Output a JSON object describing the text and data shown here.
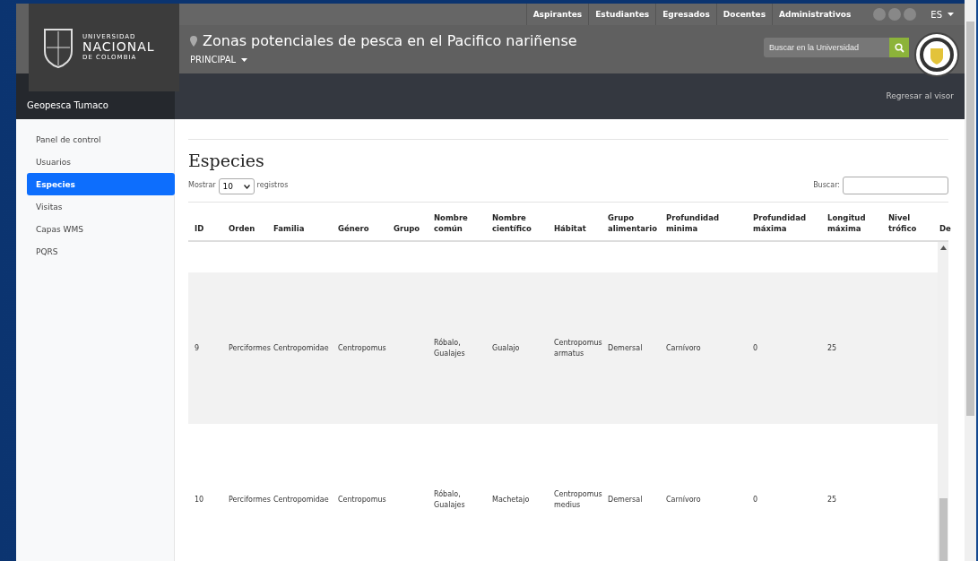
{
  "top_links": [
    "Aspirantes",
    "Estudiantes",
    "Egresados",
    "Docentes",
    "Administrativos"
  ],
  "language": "ES",
  "logo": {
    "line1": "UNIVERSIDAD",
    "line2": "NACIONAL",
    "line3": "DE COLOMBIA"
  },
  "site_title": "Zonas potenciales de pesca en el Pacifico nariñense",
  "menu": "PRINCIPAL",
  "search": {
    "placeholder": "Buscar en la Universidad"
  },
  "app_name": "Geopesca Tumaco",
  "back_link": "Regresar al visor",
  "sidebar": {
    "items": [
      {
        "label": "Panel de control",
        "selected": false
      },
      {
        "label": "Usuarios",
        "selected": false
      },
      {
        "label": "Especies",
        "selected": true
      },
      {
        "label": "Visitas",
        "selected": false
      },
      {
        "label": "Capas WMS",
        "selected": false
      },
      {
        "label": "PQRS",
        "selected": false
      }
    ]
  },
  "heading": "Especies",
  "length": {
    "before": "Mostrar",
    "value": "10",
    "after": "registros"
  },
  "filter_label": "Buscar:",
  "table": {
    "columns": [
      "ID",
      "Orden",
      "Familia",
      "Género",
      "Grupo",
      "Nombre común",
      "Nombre científico",
      "Hábitat",
      "Grupo alimentario",
      "Profundidad minima",
      "Profundidad máxima",
      "Longitud máxima",
      "Nivel trófico",
      "De"
    ],
    "rows": [
      {
        "cells": [
          "9",
          "Perciformes",
          "Centropomidae",
          "Centropomus",
          "",
          "Róbalo, Gualajes",
          "Gualajo",
          "Centropomus armatus",
          "Demersal",
          "Carnívoro",
          "0",
          "25"
        ]
      },
      {
        "cells": [
          "10",
          "Perciformes",
          "Centropomidae",
          "Centropomus",
          "",
          "Róbalo, Gualajes",
          "Machetajo",
          "Centropomus medius",
          "Demersal",
          "Carnívoro",
          "0",
          "25"
        ]
      }
    ]
  }
}
